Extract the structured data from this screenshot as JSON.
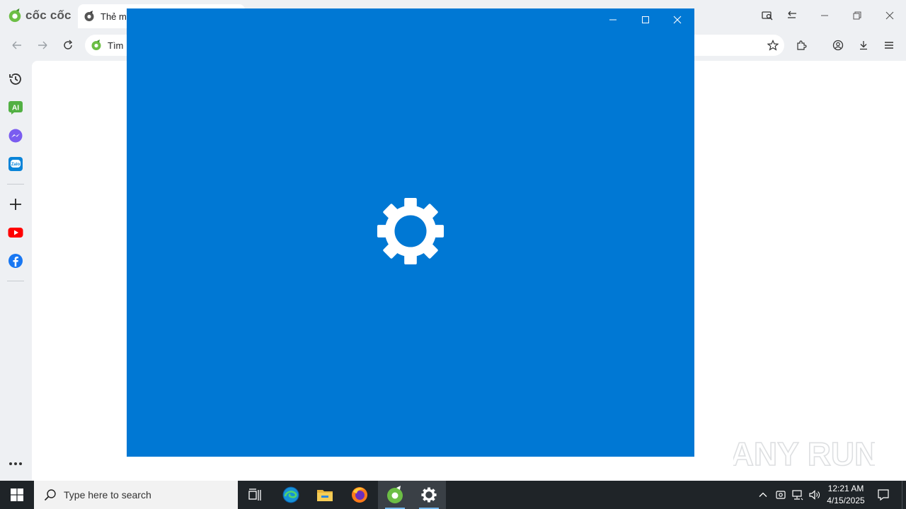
{
  "browser": {
    "brand_name": "cốc cốc",
    "tab": {
      "title": "Thẻ m"
    },
    "omnibox": {
      "text": "Tìm"
    }
  },
  "taskbar": {
    "search_placeholder": "Type here to search",
    "clock": {
      "time": "12:21 AM",
      "date": "4/15/2025"
    }
  },
  "watermark": {
    "text": "ANY RUN"
  },
  "colors": {
    "settings_accent": "#0078d4",
    "taskbar_bg": "#1f2428",
    "brand_green": "#6cbe45"
  }
}
